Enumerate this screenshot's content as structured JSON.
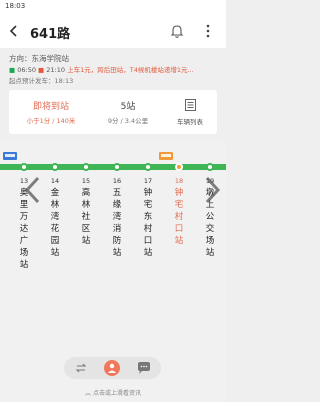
{
  "status_bar": {
    "time": "18:03"
  },
  "header": {
    "route": "641路"
  },
  "info": {
    "direction": "方向：东海学院站",
    "first_bus": "06:50",
    "last_bus": "21:10",
    "notice": "上车1元，跨后田站，T4候机楼站递增1元...",
    "departure": "起点预计发车：18:13"
  },
  "summary": {
    "arriving_label": "即将到站",
    "arriving_detail": "小于1分 / 140米",
    "stations_label": "5站",
    "stations_detail": "9分 / 3.4公里",
    "bus_list_label": "车辆列表"
  },
  "stops": [
    {
      "num": "13",
      "name": "奥里万达广场站"
    },
    {
      "num": "14",
      "name": "金林湾花园站"
    },
    {
      "num": "15",
      "name": "高林社区站"
    },
    {
      "num": "16",
      "name": "五缘湾消防站"
    },
    {
      "num": "17",
      "name": "钟宅东村口站"
    },
    {
      "num": "18",
      "name": "钟宅村口站"
    },
    {
      "num": "19",
      "name": "墩上公交场站"
    }
  ],
  "bottom_hint": "点击或上滑看资讯",
  "colors": {
    "accent": "#e26a50",
    "track": "#3fb556",
    "bus_blue": "#3a7ad6",
    "bus_orange": "#f09a3c"
  }
}
